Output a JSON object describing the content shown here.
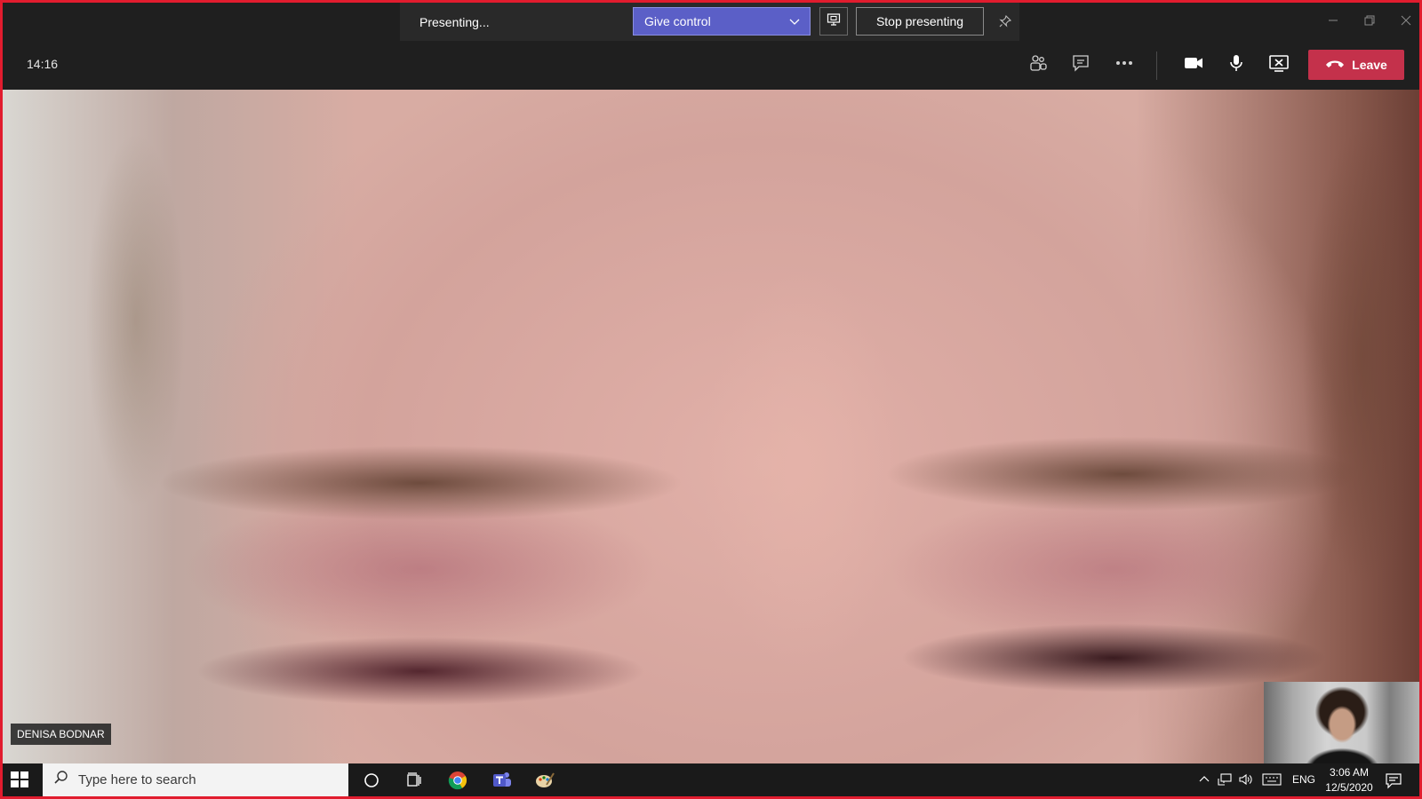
{
  "share_bar": {
    "status": "Presenting...",
    "give_control_label": "Give control",
    "stop_presenting_label": "Stop presenting"
  },
  "meeting": {
    "timer": "14:16",
    "leave_label": "Leave",
    "presenter_name": "DENISA BODNAR"
  },
  "icons": [
    "people-icon",
    "chat-icon",
    "more-icon",
    "camera-icon",
    "mic-icon",
    "share-tray-icon",
    "phone-icon",
    "pin-icon",
    "chevron-down-icon",
    "share-screen-icon"
  ],
  "colors": {
    "accent": "#5b5fc7",
    "leave": "#c4314b",
    "frame_border": "#e11c2e",
    "bar_bg": "#1f1f1f"
  },
  "taskbar": {
    "search_placeholder": "Type here to search",
    "language": "ENG",
    "time": "3:06 AM",
    "date": "12/5/2020"
  }
}
